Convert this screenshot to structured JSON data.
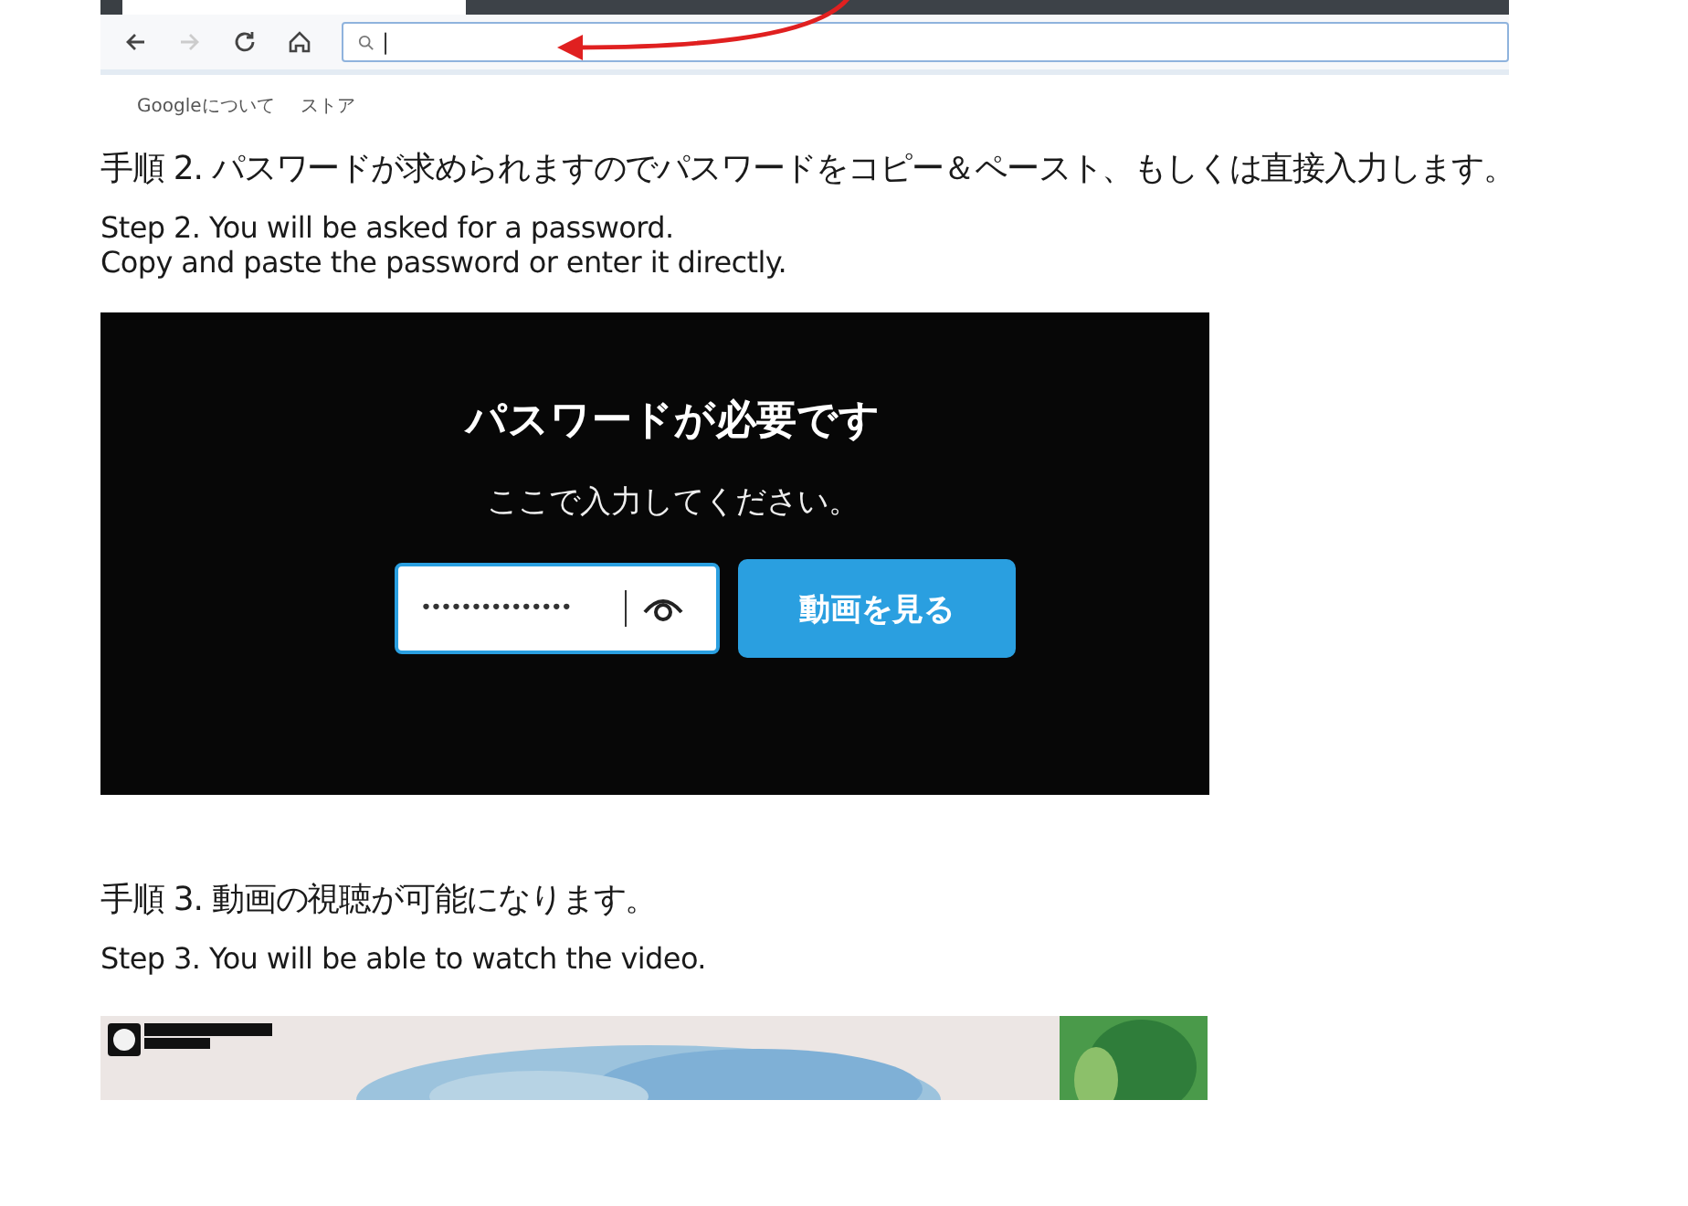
{
  "browser": {
    "search_placeholder": "|",
    "links": [
      "Googleについて",
      "ストア"
    ]
  },
  "steps": [
    {
      "heading": "手順 2. パスワードが求められますのでパスワードをコピー＆ペースト、もしくは直接入力します。",
      "english": [
        "Step 2. You will be asked for a password.",
        "Copy and paste the password or enter it directly."
      ],
      "kind": "password"
    },
    {
      "heading": "手順 3. 動画の視聴が可能になります。",
      "english": [
        "Step 3. You will be able to watch the video."
      ],
      "kind": "video"
    }
  ],
  "password_dialog": {
    "title": "パスワードが必要です",
    "message": "ここで入力してください。",
    "value": "•••••••••••••••",
    "button": "動画を見る"
  }
}
